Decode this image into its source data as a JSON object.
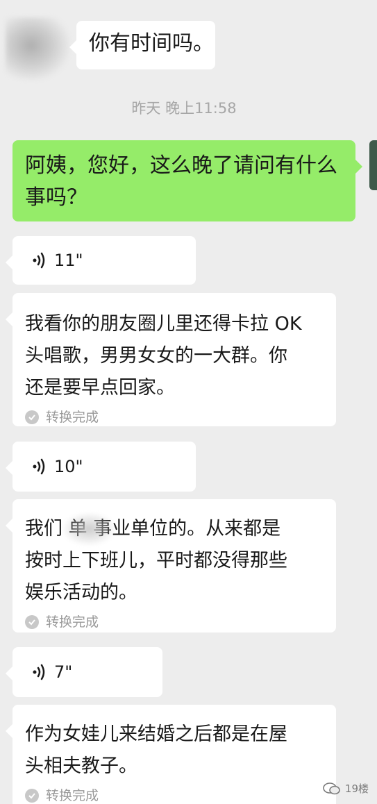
{
  "messages": {
    "top_text": "你有时间吗。",
    "timestamp": "昨天 晚上11:58",
    "sent_text": "阿姨，您好，这么晚了请问有什么事吗？",
    "voice_1": "11\"",
    "transcript_1_lines": [
      "我看你的朋友圈儿里还得卡拉 OK",
      "头唱歌，男男女女的一大群。你",
      "还是要早点回家。"
    ],
    "convert_status_1": "转换完成",
    "voice_2": "10\"",
    "transcript_2_lines": [
      "我们 单 事业单位的。从来都是",
      "按时上下班儿，平时都没得那些",
      "娱乐活动的。"
    ],
    "convert_status_2": "转换完成",
    "voice_3": "7\"",
    "transcript_3_lines": [
      "作为女娃儿来结婚之后都是在屋",
      "头相夫教子。"
    ],
    "convert_status_3": "转换完成"
  },
  "watermark": {
    "text": "19楼"
  },
  "colors": {
    "background": "#ededed",
    "bubble_received": "#ffffff",
    "bubble_sent": "#95ec69",
    "timestamp": "#a6a6a6"
  }
}
